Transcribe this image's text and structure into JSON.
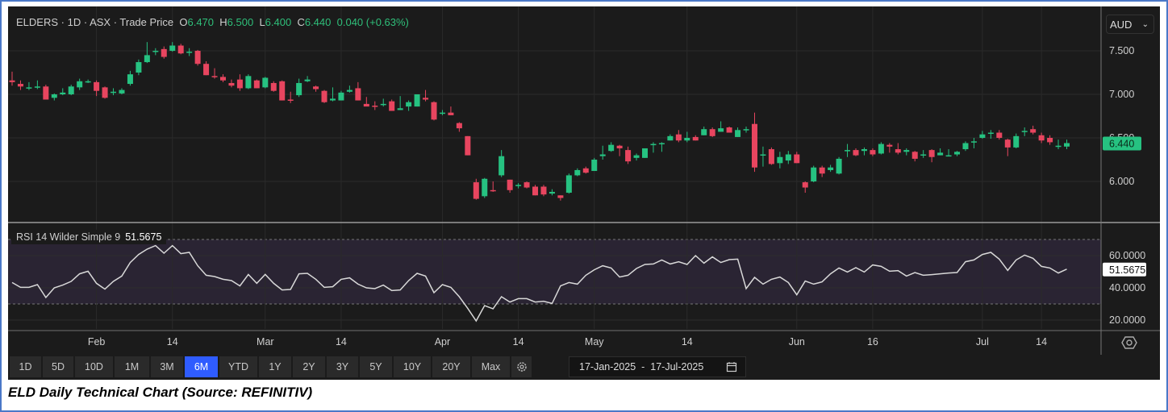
{
  "legend": {
    "symbol": "ELDERS",
    "interval": "1D",
    "exchange": "ASX",
    "price_type": "Trade Price",
    "open_label": "O",
    "open": "6.470",
    "high_label": "H",
    "high": "6.500",
    "low_label": "L",
    "low": "6.400",
    "close_label": "C",
    "close": "6.440",
    "change": "0.040 (+0.63%)"
  },
  "currency": {
    "value": "AUD",
    "icon": "chevron-down-icon"
  },
  "last_price_badge": "6.440",
  "rsi_legend": {
    "label": "RSI 14 Wilder Simple 9",
    "value": "51.5675"
  },
  "rsi_badge": "51.5675",
  "toolbar": {
    "ranges": [
      "1D",
      "5D",
      "10D",
      "1M",
      "3M",
      "6M",
      "YTD",
      "1Y",
      "2Y",
      "3Y",
      "5Y",
      "10Y",
      "20Y",
      "Max"
    ],
    "active": "6M",
    "settings_icon": "gear-icon"
  },
  "date_range": {
    "from": "17-Jan-2025",
    "sep": "-",
    "to": "17-Jul-2025",
    "icon": "calendar-icon"
  },
  "caption": "ELD Daily Technical Chart (Source: REFINITIV)",
  "colors": {
    "up": "#26c281",
    "down": "#e8455f",
    "rsi_line": "#d8d8d8",
    "rsi_band": "#2a2433",
    "background": "#1b1b1b",
    "active_button": "#2f5cff"
  },
  "chart_data": [
    {
      "type": "candlestick",
      "ylim": [
        5.62,
        7.72
      ],
      "y_ticks": [
        "7.500",
        "7.000",
        "6.500",
        "6.000"
      ],
      "grid": true,
      "x_ticks": [
        {
          "label": "Feb",
          "index": 10
        },
        {
          "label": "14",
          "index": 19
        },
        {
          "label": "Mar",
          "index": 30
        },
        {
          "label": "14",
          "index": 39
        },
        {
          "label": "Apr",
          "index": 51
        },
        {
          "label": "14",
          "index": 60
        },
        {
          "label": "May",
          "index": 69
        },
        {
          "label": "14",
          "index": 80
        },
        {
          "label": "Jun",
          "index": 93
        },
        {
          "label": "16",
          "index": 102
        },
        {
          "label": "Jul",
          "index": 115
        },
        {
          "label": "14",
          "index": 122
        }
      ],
      "ohlc": [
        [
          7.16,
          7.26,
          7.1,
          7.14
        ],
        [
          7.12,
          7.16,
          7.05,
          7.09
        ],
        [
          7.07,
          7.14,
          7.05,
          7.08
        ],
        [
          7.08,
          7.16,
          7.06,
          7.09
        ],
        [
          7.09,
          7.11,
          6.94,
          6.94
        ],
        [
          6.96,
          7.01,
          6.93,
          7.0
        ],
        [
          7.0,
          7.07,
          6.99,
          7.02
        ],
        [
          7.0,
          7.11,
          6.99,
          7.09
        ],
        [
          7.08,
          7.18,
          7.05,
          7.15
        ],
        [
          7.14,
          7.17,
          7.13,
          7.15
        ],
        [
          7.14,
          7.16,
          6.98,
          7.04
        ],
        [
          7.08,
          7.09,
          6.95,
          6.96
        ],
        [
          7.02,
          7.07,
          6.99,
          7.03
        ],
        [
          7.01,
          7.07,
          7.0,
          7.05
        ],
        [
          7.12,
          7.27,
          7.1,
          7.23
        ],
        [
          7.25,
          7.4,
          7.22,
          7.37
        ],
        [
          7.37,
          7.6,
          7.36,
          7.45
        ],
        [
          7.49,
          7.53,
          7.45,
          7.5
        ],
        [
          7.52,
          7.55,
          7.41,
          7.43
        ],
        [
          7.5,
          7.6,
          7.49,
          7.56
        ],
        [
          7.56,
          7.58,
          7.46,
          7.47
        ],
        [
          7.48,
          7.53,
          7.44,
          7.49
        ],
        [
          7.5,
          7.51,
          7.33,
          7.35
        ],
        [
          7.35,
          7.38,
          7.22,
          7.22
        ],
        [
          7.21,
          7.3,
          7.18,
          7.2
        ],
        [
          7.2,
          7.23,
          7.14,
          7.16
        ],
        [
          7.13,
          7.17,
          7.08,
          7.1
        ],
        [
          7.17,
          7.23,
          7.04,
          7.07
        ],
        [
          7.07,
          7.23,
          7.06,
          7.21
        ],
        [
          7.16,
          7.17,
          7.07,
          7.07
        ],
        [
          7.08,
          7.2,
          7.07,
          7.19
        ],
        [
          7.13,
          7.15,
          7.03,
          7.04
        ],
        [
          7.15,
          7.16,
          6.93,
          6.93
        ],
        [
          6.94,
          7.03,
          6.9,
          6.93
        ],
        [
          6.99,
          7.18,
          6.97,
          7.13
        ],
        [
          7.15,
          7.21,
          7.14,
          7.17
        ],
        [
          7.09,
          7.1,
          7.03,
          7.06
        ],
        [
          7.04,
          7.05,
          6.9,
          6.91
        ],
        [
          6.93,
          7.08,
          6.92,
          6.95
        ],
        [
          6.93,
          7.04,
          6.93,
          7.02
        ],
        [
          7.03,
          7.1,
          7.02,
          7.05
        ],
        [
          7.07,
          7.14,
          6.93,
          6.93
        ],
        [
          6.89,
          6.97,
          6.88,
          6.86
        ],
        [
          6.87,
          6.92,
          6.82,
          6.86
        ],
        [
          6.89,
          6.95,
          6.86,
          6.89
        ],
        [
          6.92,
          6.94,
          6.81,
          6.81
        ],
        [
          6.82,
          6.98,
          6.82,
          6.84
        ],
        [
          6.86,
          6.93,
          6.81,
          6.91
        ],
        [
          6.86,
          7.0,
          6.86,
          7.0
        ],
        [
          6.96,
          7.05,
          6.92,
          6.94
        ],
        [
          6.91,
          6.92,
          6.7,
          6.71
        ],
        [
          6.78,
          6.82,
          6.76,
          6.79
        ],
        [
          6.79,
          6.86,
          6.76,
          6.76
        ],
        [
          6.67,
          6.68,
          6.57,
          6.61
        ],
        [
          6.52,
          6.52,
          6.3,
          6.3
        ],
        [
          5.99,
          6.03,
          5.79,
          5.8
        ],
        [
          5.83,
          6.04,
          5.81,
          6.03
        ],
        [
          5.9,
          6.0,
          5.88,
          5.89
        ],
        [
          6.07,
          6.36,
          6.05,
          6.29
        ],
        [
          6.02,
          6.02,
          5.87,
          5.9
        ],
        [
          5.95,
          5.98,
          5.92,
          5.96
        ],
        [
          5.99,
          6.0,
          5.92,
          5.93
        ],
        [
          5.94,
          5.96,
          5.84,
          5.84
        ],
        [
          5.94,
          5.96,
          5.83,
          5.85
        ],
        [
          5.86,
          5.91,
          5.84,
          5.88
        ],
        [
          5.84,
          5.84,
          5.78,
          5.81
        ],
        [
          5.87,
          6.09,
          5.86,
          6.07
        ],
        [
          6.07,
          6.15,
          6.06,
          6.13
        ],
        [
          6.15,
          6.17,
          6.09,
          6.1
        ],
        [
          6.12,
          6.27,
          6.12,
          6.25
        ],
        [
          6.29,
          6.41,
          6.25,
          6.31
        ],
        [
          6.35,
          6.45,
          6.34,
          6.42
        ],
        [
          6.41,
          6.42,
          6.29,
          6.38
        ],
        [
          6.36,
          6.4,
          6.2,
          6.23
        ],
        [
          6.27,
          6.32,
          6.24,
          6.3
        ],
        [
          6.27,
          6.38,
          6.27,
          6.38
        ],
        [
          6.43,
          6.45,
          6.33,
          6.43
        ],
        [
          6.44,
          6.45,
          6.34,
          6.44
        ],
        [
          6.47,
          6.54,
          6.47,
          6.52
        ],
        [
          6.54,
          6.59,
          6.45,
          6.47
        ],
        [
          6.47,
          6.57,
          6.45,
          6.5
        ],
        [
          6.51,
          6.53,
          6.47,
          6.47
        ],
        [
          6.53,
          6.63,
          6.53,
          6.6
        ],
        [
          6.6,
          6.62,
          6.51,
          6.52
        ],
        [
          6.57,
          6.69,
          6.57,
          6.61
        ],
        [
          6.62,
          6.63,
          6.56,
          6.56
        ],
        [
          6.51,
          6.62,
          6.51,
          6.59
        ],
        [
          6.6,
          6.63,
          6.56,
          6.6
        ],
        [
          6.66,
          6.79,
          6.11,
          6.16
        ],
        [
          6.3,
          6.4,
          6.17,
          6.31
        ],
        [
          6.37,
          6.39,
          6.19,
          6.2
        ],
        [
          6.21,
          6.34,
          6.15,
          6.28
        ],
        [
          6.24,
          6.35,
          6.2,
          6.31
        ],
        [
          6.31,
          6.34,
          6.21,
          6.21
        ],
        [
          5.99,
          6.0,
          5.87,
          5.93
        ],
        [
          6.0,
          6.18,
          5.99,
          6.16
        ],
        [
          6.16,
          6.18,
          6.05,
          6.09
        ],
        [
          6.13,
          6.19,
          6.11,
          6.16
        ],
        [
          6.09,
          6.28,
          6.08,
          6.26
        ],
        [
          6.36,
          6.43,
          6.28,
          6.36
        ],
        [
          6.36,
          6.38,
          6.29,
          6.3
        ],
        [
          6.35,
          6.39,
          6.3,
          6.37
        ],
        [
          6.36,
          6.38,
          6.29,
          6.31
        ],
        [
          6.32,
          6.45,
          6.31,
          6.43
        ],
        [
          6.42,
          6.44,
          6.33,
          6.4
        ],
        [
          6.37,
          6.44,
          6.31,
          6.33
        ],
        [
          6.34,
          6.38,
          6.3,
          6.36
        ],
        [
          6.34,
          6.35,
          6.23,
          6.26
        ],
        [
          6.3,
          6.36,
          6.27,
          6.31
        ],
        [
          6.36,
          6.37,
          6.22,
          6.28
        ],
        [
          6.3,
          6.38,
          6.3,
          6.33
        ],
        [
          6.3,
          6.37,
          6.29,
          6.3
        ],
        [
          6.31,
          6.35,
          6.29,
          6.34
        ],
        [
          6.37,
          6.46,
          6.35,
          6.44
        ],
        [
          6.46,
          6.5,
          6.38,
          6.46
        ],
        [
          6.5,
          6.58,
          6.49,
          6.54
        ],
        [
          6.56,
          6.59,
          6.49,
          6.56
        ],
        [
          6.56,
          6.59,
          6.48,
          6.5
        ],
        [
          6.48,
          6.49,
          6.29,
          6.39
        ],
        [
          6.39,
          6.55,
          6.38,
          6.52
        ],
        [
          6.58,
          6.62,
          6.52,
          6.58
        ],
        [
          6.6,
          6.64,
          6.54,
          6.56
        ],
        [
          6.53,
          6.56,
          6.44,
          6.47
        ],
        [
          6.5,
          6.53,
          6.42,
          6.45
        ],
        [
          6.41,
          6.48,
          6.37,
          6.41
        ],
        [
          6.4,
          6.48,
          6.37,
          6.44
        ]
      ]
    },
    {
      "type": "line",
      "title": "RSI 14 Wilder Simple 9",
      "ylim": [
        14,
        82
      ],
      "y_ticks": [
        "60.0000",
        "40.0000",
        "20.0000"
      ],
      "bands": [
        30,
        70
      ],
      "values": [
        43.3,
        40.3,
        40.3,
        42,
        34,
        40,
        41.7,
        44,
        48.7,
        50.3,
        42.8,
        39.2,
        44,
        47.3,
        55.7,
        60.7,
        64,
        66.2,
        61.5,
        66.2,
        61.2,
        62,
        53.7,
        47.8,
        47,
        45.3,
        44.5,
        41.2,
        48.3,
        42.8,
        48.3,
        42.8,
        38.7,
        39,
        48.7,
        49,
        45.3,
        40.3,
        40.7,
        45.3,
        46.2,
        42.3,
        40,
        39.5,
        41.7,
        38.3,
        38.7,
        44.5,
        49,
        47.3,
        37,
        42,
        40.3,
        34.5,
        27.3,
        19.5,
        29,
        27,
        34.5,
        31.2,
        33.3,
        33.3,
        31.2,
        31.7,
        30.3,
        41.2,
        43.3,
        42.3,
        47.8,
        51.2,
        53.7,
        52.3,
        46.7,
        47.8,
        52,
        54.5,
        54.8,
        57.3,
        54.8,
        56.2,
        54.5,
        60,
        55.3,
        59.2,
        55.7,
        57.5,
        57.8,
        39.5,
        46.5,
        42.3,
        45.3,
        46.7,
        43.3,
        35.7,
        44.2,
        42.3,
        43.7,
        48.7,
        52.3,
        49.8,
        52.5,
        49.8,
        54.2,
        53.3,
        50.3,
        50.7,
        47.3,
        49.5,
        47.8,
        48.2,
        48.7,
        49.2,
        49.5,
        56.2,
        57.3,
        60.7,
        62,
        57.8,
        50.8,
        57.3,
        60.3,
        58.3,
        53.3,
        52.3,
        49.2,
        51.6
      ]
    }
  ]
}
